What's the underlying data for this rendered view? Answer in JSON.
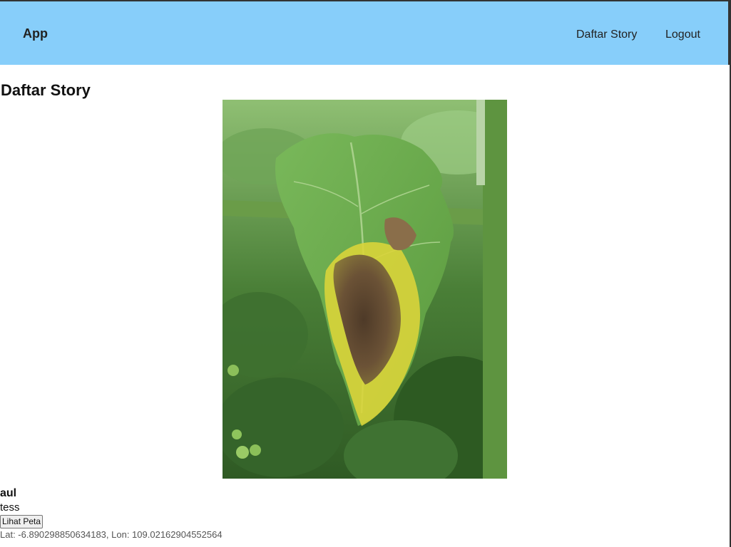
{
  "header": {
    "brand": "App",
    "nav": [
      {
        "label": "Daftar Story"
      },
      {
        "label": "Logout"
      }
    ],
    "background": "#87cefa"
  },
  "main": {
    "title": "Daftar Story",
    "stories": [
      {
        "author": "aul",
        "description": "tess",
        "map_button": "Lihat Peta",
        "coords_text": "Lat: -6.890298850634183, Lon: 109.02162904552564",
        "image_icon": "tomato-leaf-photo"
      }
    ]
  }
}
